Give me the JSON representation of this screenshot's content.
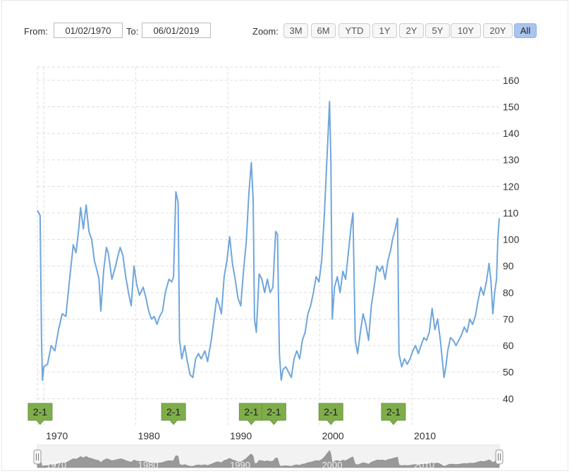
{
  "range_selector": {
    "from_label": "From:",
    "from_value": "01/02/1970",
    "to_label": "To:",
    "to_value": "06/01/2019",
    "zoom_label": "Zoom:",
    "buttons": [
      "3M",
      "6M",
      "YTD",
      "1Y",
      "2Y",
      "5Y",
      "10Y",
      "20Y",
      "All"
    ],
    "active_button": "All"
  },
  "colors": {
    "line": "#6fa6dc",
    "flag": "#7fad4c",
    "grid": "#dddddd",
    "navigator_fill": "#8a8a8a"
  },
  "chart_data": {
    "type": "line",
    "title": "",
    "xlabel": "",
    "ylabel": "",
    "xlim": [
      1969.3,
      2019.5
    ],
    "ylim": [
      30,
      165
    ],
    "y_ticks": [
      40,
      50,
      60,
      70,
      80,
      90,
      100,
      110,
      120,
      130,
      140,
      150,
      160
    ],
    "x_ticks": [
      1970,
      1980,
      1990,
      2000,
      2010
    ],
    "grid": true,
    "series": [
      {
        "name": "",
        "points": [
          [
            1969.3,
            111
          ],
          [
            1969.6,
            109
          ],
          [
            1969.75,
            62
          ],
          [
            1969.85,
            47
          ],
          [
            1970.0,
            52
          ],
          [
            1970.4,
            53
          ],
          [
            1970.8,
            60
          ],
          [
            1971.2,
            58
          ],
          [
            1971.6,
            66
          ],
          [
            1972.0,
            72
          ],
          [
            1972.4,
            71
          ],
          [
            1972.8,
            85
          ],
          [
            1973.2,
            98
          ],
          [
            1973.5,
            95
          ],
          [
            1973.8,
            104
          ],
          [
            1974.0,
            112
          ],
          [
            1974.3,
            104
          ],
          [
            1974.6,
            113
          ],
          [
            1974.9,
            103
          ],
          [
            1975.2,
            100
          ],
          [
            1975.5,
            92
          ],
          [
            1975.8,
            88
          ],
          [
            1976.0,
            85
          ],
          [
            1976.2,
            73
          ],
          [
            1976.5,
            88
          ],
          [
            1976.8,
            97
          ],
          [
            1977.0,
            95
          ],
          [
            1977.4,
            85
          ],
          [
            1977.8,
            90
          ],
          [
            1978.0,
            93
          ],
          [
            1978.3,
            97
          ],
          [
            1978.6,
            94
          ],
          [
            1978.9,
            86
          ],
          [
            1979.2,
            80
          ],
          [
            1979.5,
            75
          ],
          [
            1979.8,
            90
          ],
          [
            1980.1,
            83
          ],
          [
            1980.4,
            79
          ],
          [
            1980.8,
            82
          ],
          [
            1981.1,
            78
          ],
          [
            1981.4,
            73
          ],
          [
            1981.7,
            70
          ],
          [
            1982.0,
            71
          ],
          [
            1982.3,
            68
          ],
          [
            1982.6,
            71
          ],
          [
            1982.9,
            73
          ],
          [
            1983.2,
            80
          ],
          [
            1983.6,
            85
          ],
          [
            1983.9,
            84
          ],
          [
            1984.1,
            86
          ],
          [
            1984.35,
            118
          ],
          [
            1984.6,
            114
          ],
          [
            1984.75,
            62
          ],
          [
            1985.0,
            55
          ],
          [
            1985.3,
            60
          ],
          [
            1985.6,
            54
          ],
          [
            1985.9,
            49
          ],
          [
            1986.2,
            48
          ],
          [
            1986.5,
            55
          ],
          [
            1986.8,
            57
          ],
          [
            1987.1,
            55
          ],
          [
            1987.5,
            58
          ],
          [
            1987.8,
            54
          ],
          [
            1988.2,
            62
          ],
          [
            1988.5,
            70
          ],
          [
            1988.8,
            78
          ],
          [
            1989.0,
            76
          ],
          [
            1989.3,
            72
          ],
          [
            1989.6,
            86
          ],
          [
            1989.9,
            92
          ],
          [
            1990.2,
            101
          ],
          [
            1990.5,
            91
          ],
          [
            1990.8,
            85
          ],
          [
            1991.1,
            78
          ],
          [
            1991.4,
            75
          ],
          [
            1991.7,
            88
          ],
          [
            1992.0,
            99
          ],
          [
            1992.3,
            118
          ],
          [
            1992.55,
            129
          ],
          [
            1992.75,
            115
          ],
          [
            1992.9,
            70
          ],
          [
            1993.1,
            65
          ],
          [
            1993.4,
            87
          ],
          [
            1993.7,
            85
          ],
          [
            1994.0,
            80
          ],
          [
            1994.3,
            85
          ],
          [
            1994.6,
            80
          ],
          [
            1994.9,
            82
          ],
          [
            1995.2,
            103
          ],
          [
            1995.4,
            102
          ],
          [
            1995.6,
            57
          ],
          [
            1995.8,
            47
          ],
          [
            1996.0,
            51
          ],
          [
            1996.3,
            52
          ],
          [
            1996.6,
            50
          ],
          [
            1996.9,
            48
          ],
          [
            1997.2,
            55
          ],
          [
            1997.5,
            58
          ],
          [
            1997.8,
            55
          ],
          [
            1998.1,
            62
          ],
          [
            1998.4,
            65
          ],
          [
            1998.7,
            72
          ],
          [
            1999.0,
            75
          ],
          [
            1999.3,
            80
          ],
          [
            1999.6,
            86
          ],
          [
            1999.9,
            84
          ],
          [
            2000.2,
            92
          ],
          [
            2000.5,
            110
          ],
          [
            2000.7,
            125
          ],
          [
            2000.9,
            140
          ],
          [
            2001.05,
            152
          ],
          [
            2001.2,
            130
          ],
          [
            2001.35,
            70
          ],
          [
            2001.6,
            82
          ],
          [
            2001.9,
            86
          ],
          [
            2002.2,
            80
          ],
          [
            2002.5,
            88
          ],
          [
            2002.8,
            85
          ],
          [
            2003.1,
            95
          ],
          [
            2003.4,
            105
          ],
          [
            2003.6,
            110
          ],
          [
            2003.85,
            62
          ],
          [
            2004.1,
            57
          ],
          [
            2004.4,
            65
          ],
          [
            2004.7,
            72
          ],
          [
            2005.0,
            68
          ],
          [
            2005.3,
            62
          ],
          [
            2005.6,
            75
          ],
          [
            2005.9,
            82
          ],
          [
            2006.2,
            90
          ],
          [
            2006.5,
            88
          ],
          [
            2006.8,
            90
          ],
          [
            2007.1,
            85
          ],
          [
            2007.4,
            92
          ],
          [
            2007.7,
            96
          ],
          [
            2007.9,
            100
          ],
          [
            2008.2,
            104
          ],
          [
            2008.45,
            108
          ],
          [
            2008.6,
            57
          ],
          [
            2008.9,
            52
          ],
          [
            2009.2,
            55
          ],
          [
            2009.5,
            53
          ],
          [
            2009.8,
            55
          ],
          [
            2010.1,
            58
          ],
          [
            2010.4,
            60
          ],
          [
            2010.7,
            57
          ],
          [
            2011.0,
            60
          ],
          [
            2011.3,
            63
          ],
          [
            2011.6,
            62
          ],
          [
            2011.9,
            65
          ],
          [
            2012.2,
            74
          ],
          [
            2012.5,
            66
          ],
          [
            2012.8,
            70
          ],
          [
            2013.1,
            62
          ],
          [
            2013.3,
            55
          ],
          [
            2013.5,
            48
          ],
          [
            2013.7,
            52
          ],
          [
            2013.9,
            58
          ],
          [
            2014.2,
            63
          ],
          [
            2014.5,
            62
          ],
          [
            2014.8,
            60
          ],
          [
            2015.1,
            62
          ],
          [
            2015.4,
            64
          ],
          [
            2015.7,
            67
          ],
          [
            2016.0,
            65
          ],
          [
            2016.3,
            70
          ],
          [
            2016.6,
            68
          ],
          [
            2016.9,
            71
          ],
          [
            2017.2,
            77
          ],
          [
            2017.5,
            82
          ],
          [
            2017.8,
            79
          ],
          [
            2018.1,
            84
          ],
          [
            2018.4,
            91
          ],
          [
            2018.6,
            84
          ],
          [
            2018.8,
            72
          ],
          [
            2019.0,
            80
          ],
          [
            2019.2,
            85
          ],
          [
            2019.35,
            100
          ],
          [
            2019.5,
            108
          ]
        ]
      }
    ],
    "flags": [
      {
        "label": "2-1",
        "x": 1969.6
      },
      {
        "label": "2-1",
        "x": 1984.1
      },
      {
        "label": "2-1",
        "x": 1992.55
      },
      {
        "label": "2-1",
        "x": 1995.0
      },
      {
        "label": "2-1",
        "x": 2001.2
      },
      {
        "label": "2-1",
        "x": 2008.0
      }
    ],
    "navigator": {
      "tick_labels": [
        "1970",
        "1980",
        "1990",
        "2000",
        "2010"
      ]
    }
  }
}
